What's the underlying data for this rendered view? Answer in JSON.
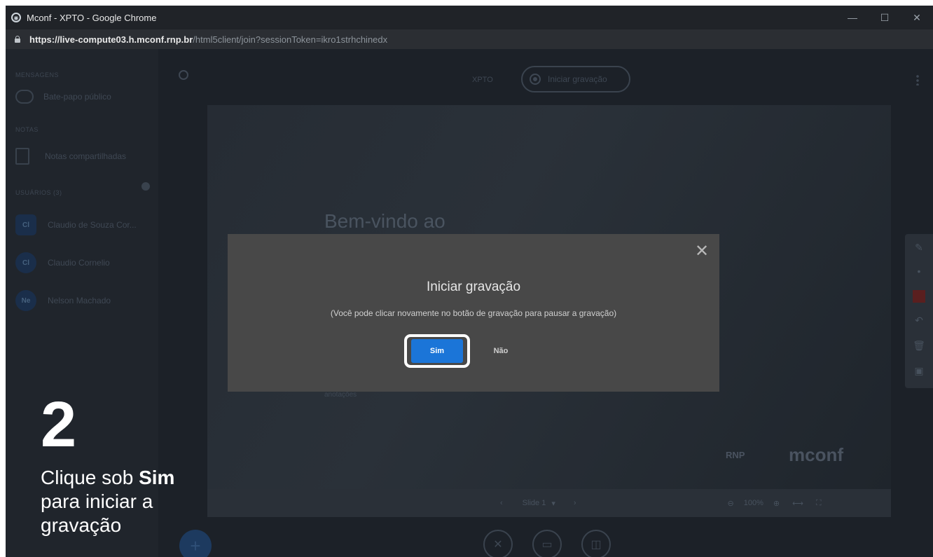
{
  "browser": {
    "title": "Mconf - XPTO - Google Chrome",
    "url_host": "https://live-compute03.h.mconf.rnp.br",
    "url_path": "/html5client/join?sessionToken=ikro1strhchinedx",
    "controls": [
      "—",
      "☐",
      "✕"
    ]
  },
  "sidebar": {
    "messages_header": "MENSAGENS",
    "public_chat": "Bate-papo público",
    "notes_header": "NOTAS",
    "shared_notes": "Notas compartilhadas",
    "users_header": "USUÁRIOS (3)",
    "users": [
      {
        "initials": "Cl",
        "name": "Claudio de Souza Cor..."
      },
      {
        "initials": "Cl",
        "name": "Claudio Cornelio"
      },
      {
        "initials": "Ne",
        "name": "Nelson Machado"
      }
    ]
  },
  "overlay": {
    "step_number": "2",
    "step_prefix": "Clique sob ",
    "step_bold": "Sim",
    "step_suffix": " para iniciar a gravação"
  },
  "topbar": {
    "meeting_name": "XPTO",
    "record_label": "Iniciar gravação"
  },
  "slide": {
    "title": "Bem-vindo ao",
    "annotation": "anotações",
    "rnp_logo": "RNP",
    "mconf_logo": "mconf",
    "nav_label": "Slide 1",
    "zoom": "100%"
  },
  "modal": {
    "title": "Iniciar gravação",
    "description": "(Você pode clicar novamente no botão de gravação para pausar a gravação)",
    "confirm_label": "Sim",
    "cancel_label": "Não"
  },
  "colors": {
    "primary_button": "#1b75d8",
    "modal_bg": "#484848",
    "highlight": "#ffffff"
  }
}
